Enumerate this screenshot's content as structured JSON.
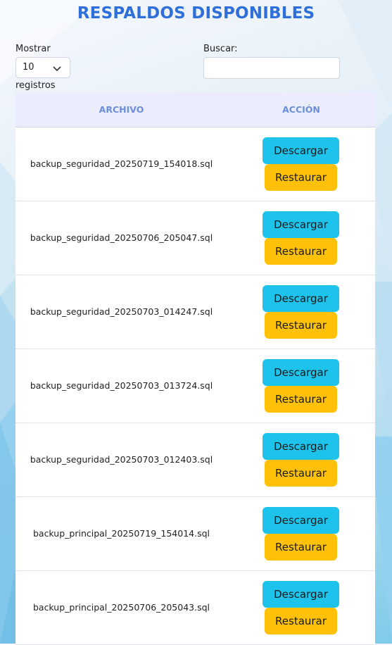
{
  "title": "RESPALDOS DISPONIBLES",
  "length_menu": {
    "label": "Mostrar",
    "value": "10",
    "suffix": "registros"
  },
  "search": {
    "label": "Buscar:",
    "value": "",
    "placeholder": ""
  },
  "table": {
    "headers": {
      "file": "ARCHIVO",
      "action": "ACCIÓN"
    },
    "download_label": "Descargar",
    "restore_label": "Restaurar",
    "rows": [
      {
        "file": "backup_seguridad_20250719_154018.sql",
        "download": "Descargar",
        "restore": "Restaurar"
      },
      {
        "file": "backup_seguridad_20250706_205047.sql",
        "download": "Descargar",
        "restore": "Restaurar"
      },
      {
        "file": "backup_seguridad_20250703_014247.sql",
        "download": "Descargar",
        "restore": "Restaurar"
      },
      {
        "file": "backup_seguridad_20250703_013724.sql",
        "download": "Descargar",
        "restore": "Restaurar"
      },
      {
        "file": "backup_seguridad_20250703_012403.sql",
        "download": "Descargar",
        "restore": "Restaurar"
      },
      {
        "file": "backup_principal_20250719_154014.sql",
        "download": "Descargar",
        "restore": "Restaurar"
      },
      {
        "file": "backup_principal_20250706_205043.sql",
        "download": "Descargar",
        "restore": "Restaurar"
      }
    ]
  },
  "colors": {
    "title": "#2f6fd9",
    "header_bg": "#ecedfc",
    "header_text": "#6a8ed8",
    "download_button": "#1ec3ec",
    "restore_button": "#fec107"
  },
  "icons": {
    "select_arrow": "chevron-down-icon"
  }
}
